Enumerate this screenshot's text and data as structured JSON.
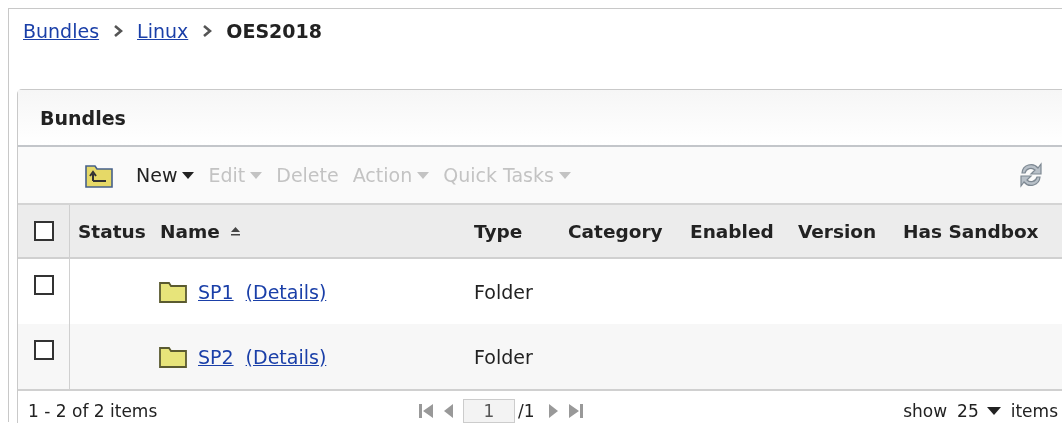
{
  "breadcrumb": [
    {
      "label": "Bundles",
      "kind": "link"
    },
    {
      "label": "Linux",
      "kind": "link"
    },
    {
      "label": "OES2018",
      "kind": "current"
    }
  ],
  "panel": {
    "title": "Bundles"
  },
  "toolbar": [
    {
      "label": "New",
      "menu": true,
      "disabled": false
    },
    {
      "label": "Edit",
      "menu": true,
      "disabled": true
    },
    {
      "label": "Delete",
      "menu": false,
      "disabled": true
    },
    {
      "label": "Action",
      "menu": true,
      "disabled": true
    },
    {
      "label": "Quick Tasks",
      "menu": true,
      "disabled": true
    }
  ],
  "table": {
    "select_all": {
      "checked": false
    },
    "columns": [
      {
        "label": "Status",
        "sorted": false
      },
      {
        "label": "Name",
        "sorted": true
      },
      {
        "label": "Type",
        "sorted": false
      },
      {
        "label": "Category",
        "sorted": false
      },
      {
        "label": "Enabled",
        "sorted": false
      },
      {
        "label": "Version",
        "sorted": false
      },
      {
        "label": "Has Sandbox",
        "sorted": false
      }
    ],
    "rows": [
      {
        "checked": false,
        "name": "SP1",
        "details": "(Details)",
        "type": "Folder"
      },
      {
        "checked": false,
        "name": "SP2",
        "details": "(Details)",
        "type": "Folder"
      }
    ]
  },
  "footer": {
    "range": "1 - 2 of 2 items",
    "page": "1",
    "page_total": "/1",
    "show": "show",
    "page_size": "25",
    "items": "items"
  }
}
